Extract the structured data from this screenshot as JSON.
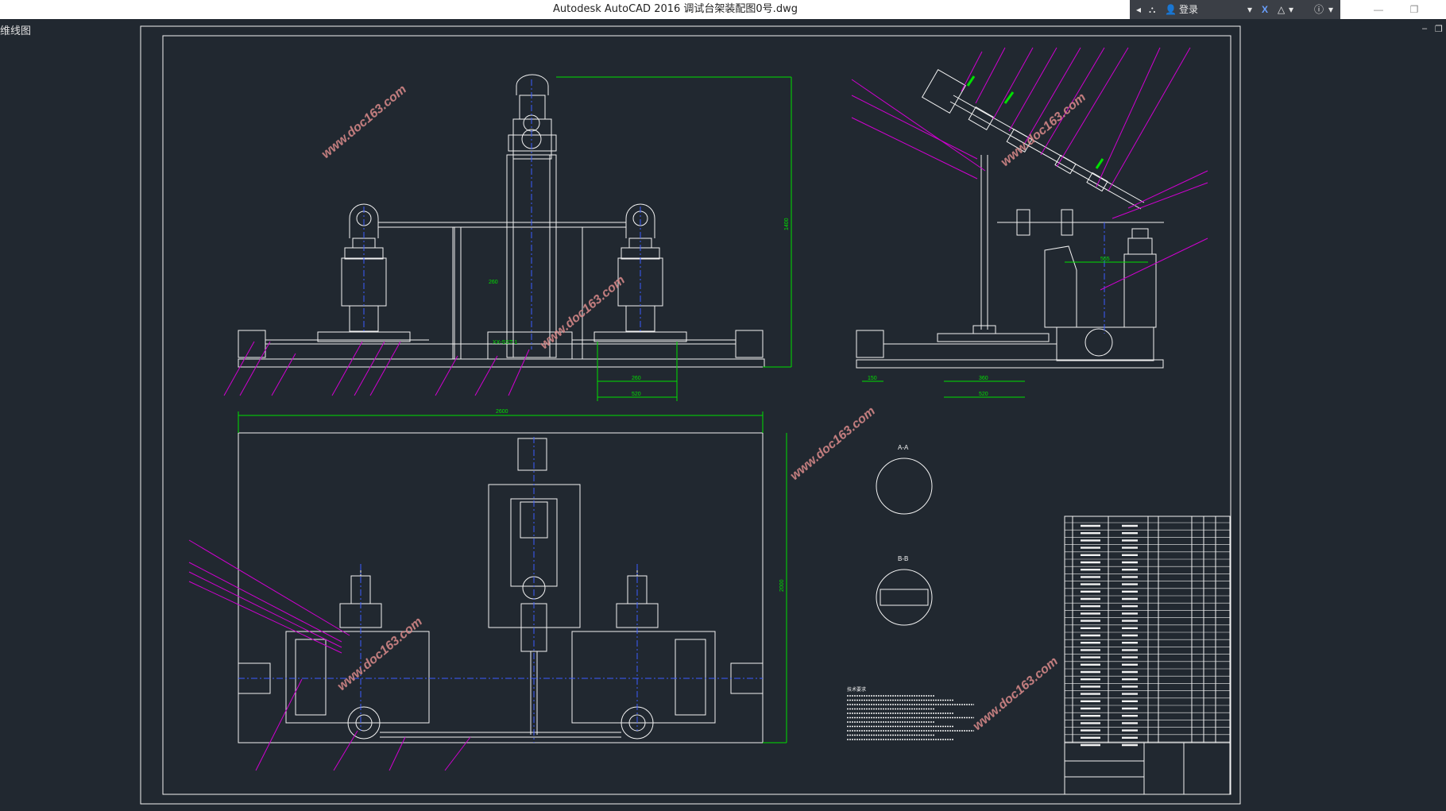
{
  "window": {
    "title": "Autodesk AutoCAD 2016     调试台架装配图0号.dwg",
    "signin_label": "登录",
    "minimize": "—",
    "restore": "❐"
  },
  "viewport": {
    "label": "维线图",
    "minimize": "‒",
    "restore": "❐"
  },
  "watermark": "www.doc163.com",
  "dimensions": {
    "front_height": "1400",
    "front_width_small": "260",
    "front_base_1": "260",
    "front_base_2": "520",
    "side_base_1": "150",
    "side_base_2": "360",
    "side_base_3": "520",
    "side_top": "565",
    "top_width": "2600",
    "top_height": "2000",
    "top_gear_label": "XX-SST-1"
  },
  "section_labels": [
    "A-A",
    "B-B"
  ],
  "notes_title": "技术要求",
  "colors": {
    "line": "#f2f2f2",
    "dim": "#00e000",
    "leader": "#d000d0",
    "center": "#3b5bff",
    "background": "#212830"
  }
}
